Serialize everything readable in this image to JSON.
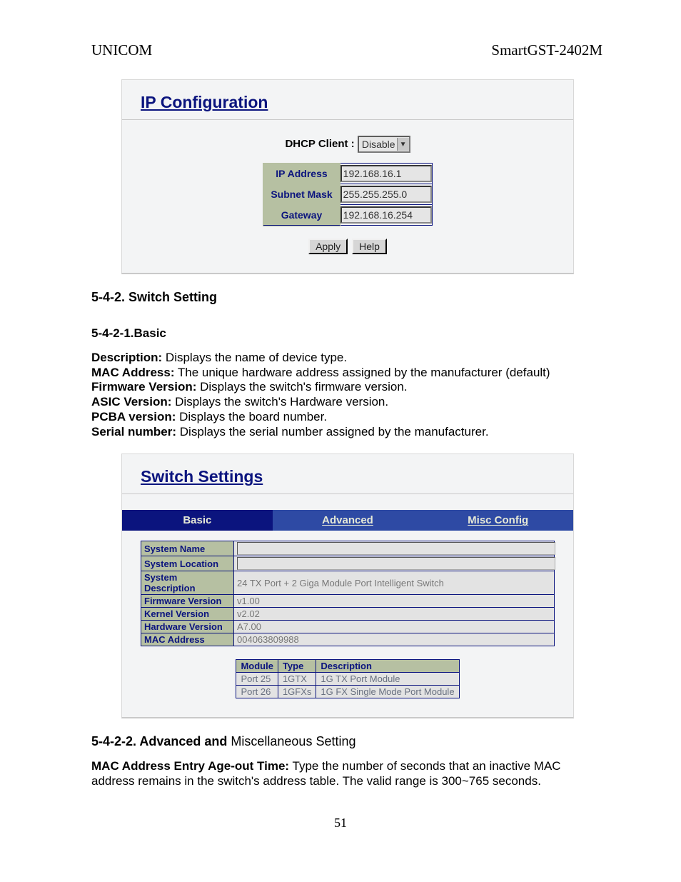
{
  "header": {
    "left": "UNICOM",
    "right": "SmartGST-2402M"
  },
  "ipconfig": {
    "title": "IP Configuration",
    "dhcp_label": "DHCP Client : ",
    "dhcp_value": "Disable",
    "rows": {
      "ip_label": "IP Address",
      "ip_value": "192.168.16.1",
      "mask_label": "Subnet Mask",
      "mask_value": "255.255.255.0",
      "gw_label": "Gateway",
      "gw_value": "192.168.16.254"
    },
    "buttons": {
      "apply": "Apply",
      "help": "Help"
    }
  },
  "sections": {
    "s542": "5-4-2. Switch Setting",
    "s5421": "5-4-2-1.Basic",
    "desc": {
      "d1b": "Description:",
      "d1t": " Displays the name of device type.",
      "d2b": "MAC Address:",
      "d2t": " The unique hardware address assigned by the manufacturer (default)",
      "d3b": "Firmware Version:",
      "d3t": " Displays the switch's firmware version.",
      "d4b": "ASIC Version:",
      "d4t": " Displays the switch's Hardware version.",
      "d5b": "PCBA version:",
      "d5t": " Displays the board number.",
      "d6b": "Serial number:",
      "d6t": " Displays the serial number assigned by the manufacturer."
    },
    "s5422b": "5-4-2-2. Advanced and ",
    "s5422l": "Miscellaneous Setting",
    "mac_age_b": "MAC Address Entry Age-out Time:",
    "mac_age_t": " Type the number of seconds that an inactive MAC address remains in the switch's address table. The valid range is 300~765 seconds."
  },
  "switch_settings": {
    "title": "Switch Settings",
    "tabs": {
      "basic": "Basic",
      "advanced": "Advanced",
      "misc": "Misc Config"
    },
    "table": {
      "r1": {
        "k": "System Name",
        "v": ""
      },
      "r2": {
        "k": "System Location",
        "v": ""
      },
      "r3": {
        "k": "System Description",
        "v": "24 TX Port + 2 Giga Module Port Intelligent Switch"
      },
      "r4": {
        "k": "Firmware Version",
        "v": "v1.00"
      },
      "r5": {
        "k": "Kernel Version",
        "v": "v2.02"
      },
      "r6": {
        "k": "Hardware Version",
        "v": "A7.00"
      },
      "r7": {
        "k": "MAC Address",
        "v": "004063809988"
      }
    },
    "mod_header": {
      "c1": "Module",
      "c2": "Type",
      "c3": "Description"
    },
    "mod_rows": {
      "r1": {
        "c1": "Port 25",
        "c2": "1GTX",
        "c3": "1G TX Port Module"
      },
      "r2": {
        "c1": "Port 26",
        "c2": "1GFXs",
        "c3": "1G FX Single Mode Port Module"
      }
    }
  },
  "page_number": "51"
}
